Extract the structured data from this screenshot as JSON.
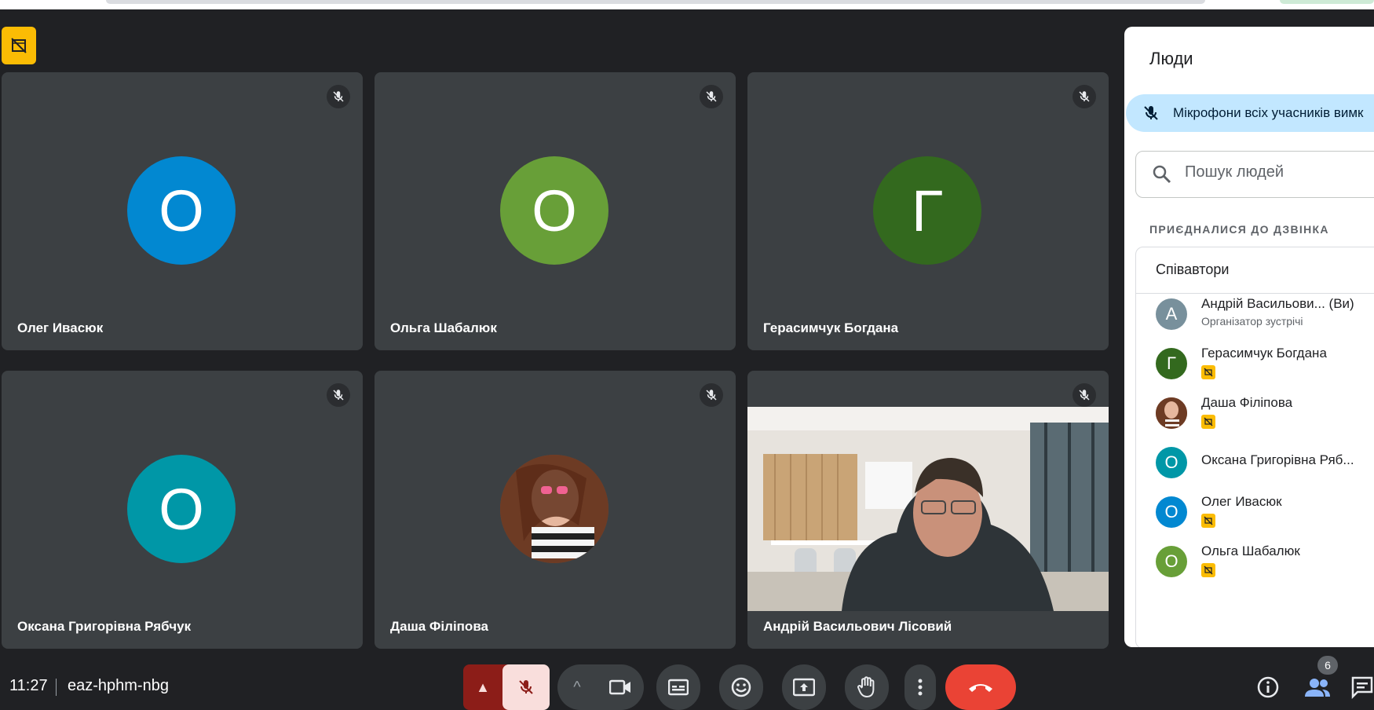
{
  "meeting": {
    "time": "11:27",
    "code": "eaz-hphm-nbg"
  },
  "tiles": [
    {
      "name": "Олег Ивасюк",
      "initial": "О",
      "color": "#0288d1"
    },
    {
      "name": "Ольга Шабалюк",
      "initial": "О",
      "color": "#689f38"
    },
    {
      "name": "Герасимчук Богдана",
      "initial": "Г",
      "color": "#33691e"
    },
    {
      "name": "Оксана Григорівна Рябчук",
      "initial": "О",
      "color": "#0097a7"
    },
    {
      "name": "Даша Філіпова",
      "initial": "",
      "color": ""
    },
    {
      "name": "Андрій Васильович Лісовий",
      "initial": "",
      "color": ""
    }
  ],
  "panel": {
    "title": "Люди",
    "banner": "Мікрофони всіх учасників вимк",
    "search_placeholder": "Пошук людей",
    "section": "ПРИЄДНАЛИСЯ ДО ДЗВІНКА",
    "group": "Співавтори",
    "people": [
      {
        "name": "Андрій Васильови...  (Ви)",
        "sub": "Організатор зустрічі",
        "initial": "А",
        "color": "#78909c"
      },
      {
        "name": "Герасимчук Богдана",
        "initial": "Г",
        "color": "#33691e"
      },
      {
        "name": "Даша Філіпова",
        "initial": "",
        "color": "#8b4a2e"
      },
      {
        "name": "Оксана Григорівна Ряб...",
        "initial": "О",
        "color": "#0097a7"
      },
      {
        "name": "Олег Ивасюк",
        "initial": "О",
        "color": "#0288d1"
      },
      {
        "name": "Ольга Шабалюк",
        "initial": "О",
        "color": "#689f38"
      }
    ]
  },
  "controls": {
    "participant_count": "6"
  },
  "colors": {
    "end_call": "#ea4335",
    "mic_off_bg": "#f9dedc",
    "mic_off_group": "#8c1d18",
    "warning": "#fbbc04"
  }
}
